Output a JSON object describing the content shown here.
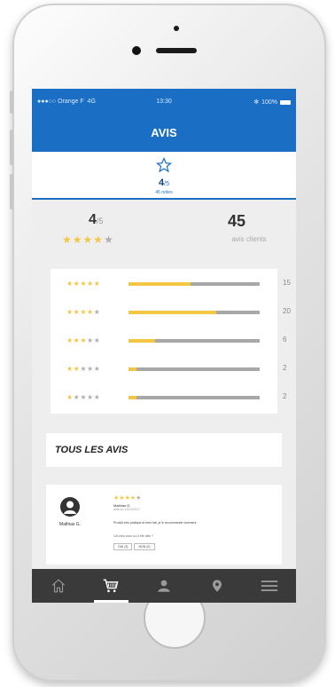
{
  "status_bar": {
    "carrier": "●●●○○ Orange F",
    "network": "4G",
    "time": "13:30",
    "bluetooth": "✻",
    "battery": "100%"
  },
  "header": {
    "title": "AVIS"
  },
  "summary_tab": {
    "score": "4",
    "score_suffix": "/5",
    "count_label": "45 notes"
  },
  "overall": {
    "score": "4",
    "score_suffix": "/5",
    "stars_filled": 4,
    "stars_total": 5,
    "count": "45",
    "count_label": "avis clients"
  },
  "distribution": [
    {
      "stars": 5,
      "count": "15",
      "fill": 0.47
    },
    {
      "stars": 4,
      "count": "20",
      "fill": 0.67
    },
    {
      "stars": 3,
      "count": "6",
      "fill": 0.2
    },
    {
      "stars": 2,
      "count": "2",
      "fill": 0.06
    },
    {
      "stars": 1,
      "count": "2",
      "fill": 0.06
    }
  ],
  "all_reviews": {
    "title": "TOUS LES AVIS"
  },
  "review": {
    "author": "Mathias G.",
    "stars_filled": 4,
    "name": "Mathias G.",
    "date": "Avis du 12/01/2017",
    "text": "Produit très pratique et bien fait, je le recommande vivement",
    "question": "Cet avis vous a-t-il été utile ?",
    "yes_label": "OUI (3)",
    "no_label": "NON (0)"
  },
  "colors": {
    "brand": "#1a6fc4",
    "star": "#f2c744",
    "tabbar": "#3a3a3a"
  },
  "tabbar": {
    "items": [
      "home-icon",
      "cart-icon",
      "user-icon",
      "location-icon",
      "menu-icon"
    ],
    "active_index": 1
  }
}
